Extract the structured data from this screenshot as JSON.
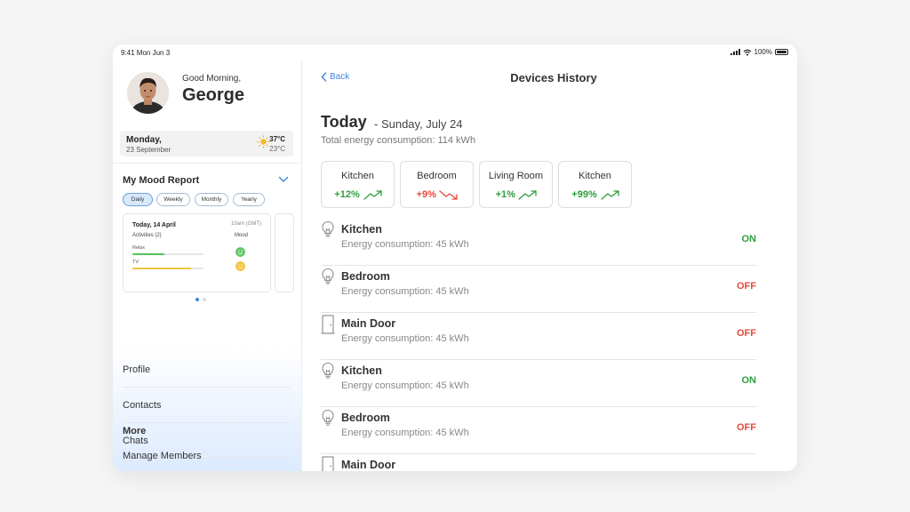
{
  "status_bar": {
    "time": "9:41  Mon Jun 3",
    "battery": "100%"
  },
  "sidebar": {
    "greeting": "Good Morning,",
    "user_name": "George",
    "day_name": "Monday,",
    "day_date": "23 September",
    "weather_high": "37°C",
    "weather_low": "23°C",
    "mood_title": "My Mood Report",
    "mood_tabs": [
      "Daily",
      "Weekly",
      "Monthly",
      "Yearly"
    ],
    "mood_card": {
      "date": "Today, 14 April",
      "time": "10am (GMT)",
      "activities": "Activities (2)",
      "mood_label": "Mood",
      "activity_1": "Relax",
      "activity_1_level": 0.45,
      "activity_2": "TV",
      "activity_2_level": 0.82
    },
    "menu": [
      "Profile",
      "Contacts",
      "Chats"
    ],
    "more_label": "More",
    "manage_members": "Manage Members"
  },
  "main": {
    "back_label": "Back",
    "title": "Devices History",
    "today_label": "Today",
    "today_date": "- Sunday, July 24",
    "total_energy": "Total energy consumption: 114 kWh",
    "rooms": [
      {
        "name": "Kitchen",
        "change": "+12%",
        "direction": "up"
      },
      {
        "name": "Bedroom",
        "change": "+9%",
        "direction": "down"
      },
      {
        "name": "Living Room",
        "change": "+1%",
        "direction": "up"
      },
      {
        "name": "Kitchen",
        "change": "+99%",
        "direction": "up"
      }
    ],
    "devices": [
      {
        "name": "Kitchen",
        "consumption": "Energy consumption: 45 kWh",
        "status": "ON",
        "icon": "bulb-icon"
      },
      {
        "name": "Bedroom",
        "consumption": "Energy consumption: 45 kWh",
        "status": "OFF",
        "icon": "bulb-icon"
      },
      {
        "name": "Main Door",
        "consumption": "Energy consumption: 45 kWh",
        "status": "OFF",
        "icon": "door-icon"
      },
      {
        "name": "Kitchen",
        "consumption": "Energy consumption: 45 kWh",
        "status": "ON",
        "icon": "bulb-icon"
      },
      {
        "name": "Bedroom",
        "consumption": "Energy consumption: 45 kWh",
        "status": "OFF",
        "icon": "bulb-icon"
      },
      {
        "name": "Main Door",
        "consumption": "",
        "status": "",
        "icon": "door-icon"
      }
    ]
  },
  "colors": {
    "accent": "#3d86de",
    "on": "#2e9e3e",
    "off": "#e8473a",
    "up": "#2e9e3e",
    "down": "#e8473a"
  }
}
